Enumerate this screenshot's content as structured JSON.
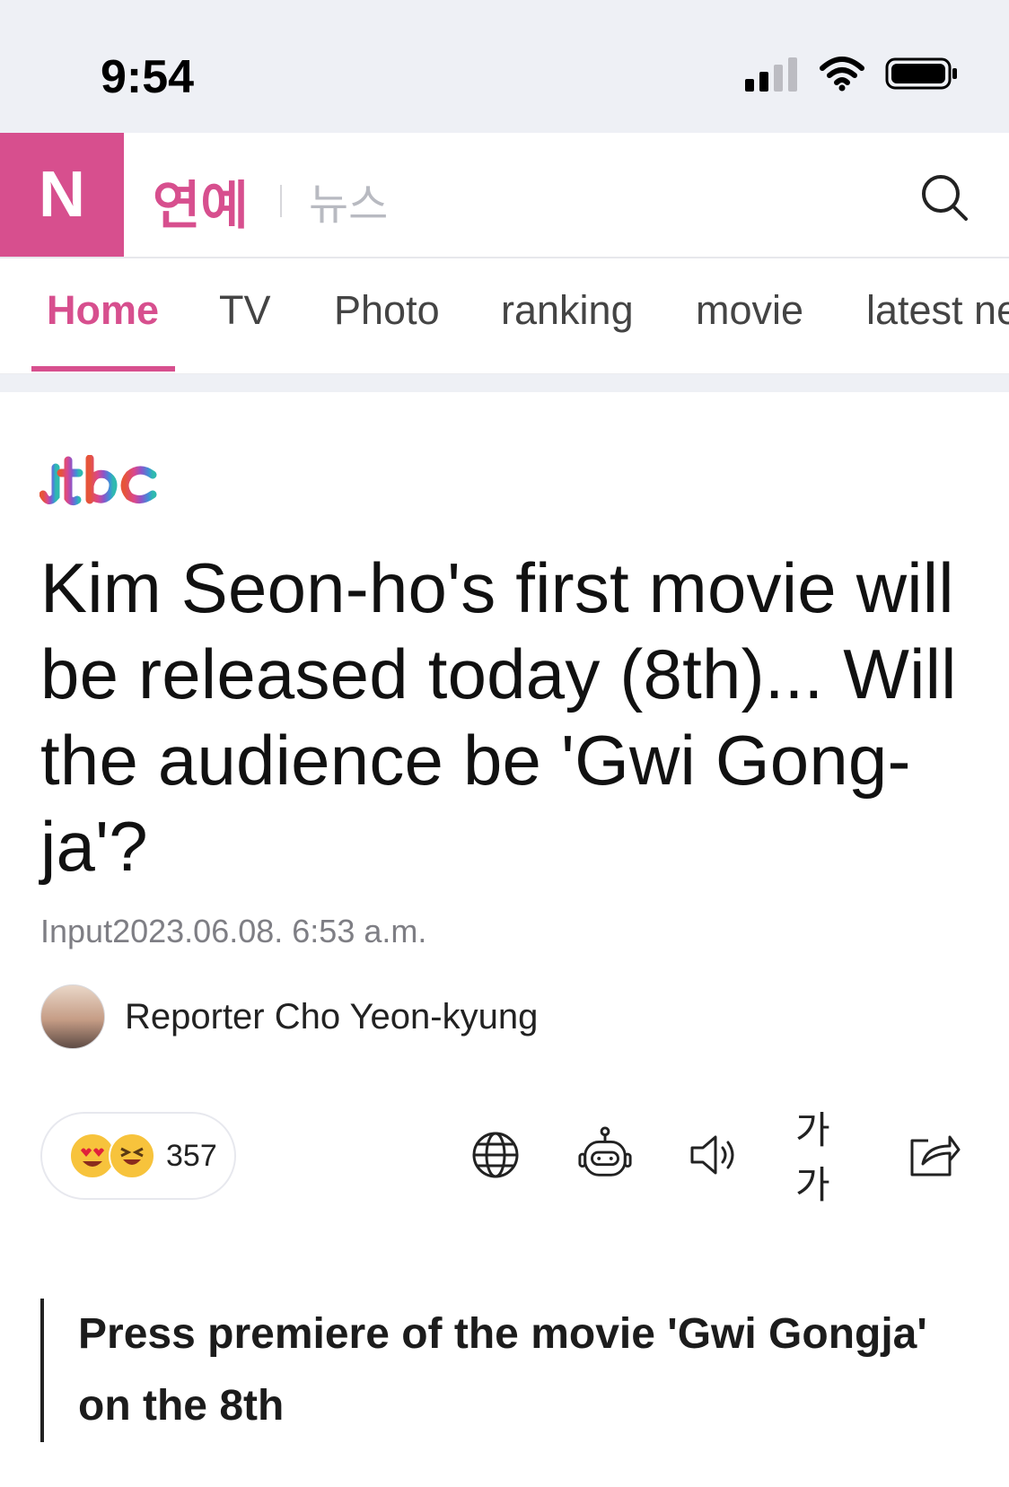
{
  "status_bar": {
    "time": "9:54"
  },
  "header": {
    "brand_letter": "N",
    "brand_section": "연예",
    "brand_sub": "뉴스",
    "search_icon": "search-icon"
  },
  "tabs": [
    {
      "label": "Home",
      "active": true
    },
    {
      "label": "TV",
      "active": false
    },
    {
      "label": "Photo",
      "active": false
    },
    {
      "label": "ranking",
      "active": false
    },
    {
      "label": "movie",
      "active": false
    },
    {
      "label": "latest ne",
      "active": false
    }
  ],
  "article": {
    "source_logo": "jtbc",
    "headline": "Kim Seon-ho's first movie will be released today (8th)... Will the audience be 'Gwi Gong-ja'?",
    "input_label": "Input",
    "input_date": "2023.06.08",
    "input_time": ". 6:53 a.m.",
    "reporter": "Reporter Cho Yeon-kyung",
    "reaction_count": "357",
    "summary": "Press premiere of the movie 'Gwi Gongja' on the 8th"
  },
  "toolbar": {
    "font_size_label": "가가"
  },
  "colors": {
    "brand": "#d74f8e",
    "status_bg": "#eef0f5",
    "text_primary": "#111111",
    "text_muted": "#7e7e84"
  }
}
